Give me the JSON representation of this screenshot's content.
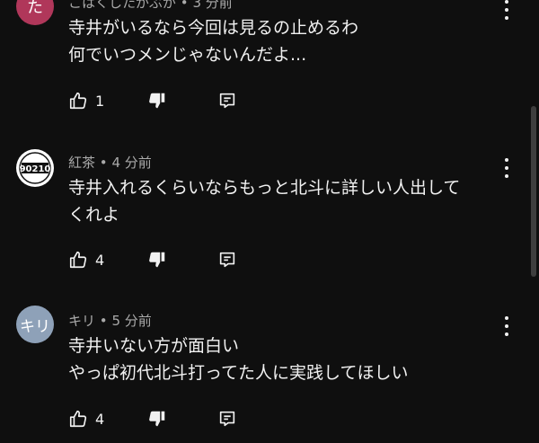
{
  "comments": [
    {
      "author": "こはくしたがぶが",
      "time_ago": "3 分前",
      "avatar_text": "た",
      "avatar_color": "#b0375a",
      "lines": [
        "寺井がいるなら今回は見るの止めるわ",
        "何でいつメンじゃないんだよ..."
      ],
      "likes": "1"
    },
    {
      "author": "紅茶",
      "time_ago": "4 分前",
      "avatar_text": "90210",
      "avatar_color": "#ffffff",
      "lines": [
        "寺井入れるくらいならもっと北斗に詳しい人出して",
        "くれよ"
      ],
      "likes": "4"
    },
    {
      "author": "キリ",
      "time_ago": "5 分前",
      "avatar_text": "キリ",
      "avatar_color": "#8ea1b8",
      "lines": [
        "寺井いない方が面白い",
        "やっぱ初代北斗打ってた人に実践してほしい"
      ],
      "likes": "4"
    }
  ],
  "separator": "•",
  "icons": {
    "like": "thumbs-up-icon",
    "dislike": "thumbs-down-icon",
    "reply": "reply-icon",
    "menu": "more-vert-icon"
  }
}
